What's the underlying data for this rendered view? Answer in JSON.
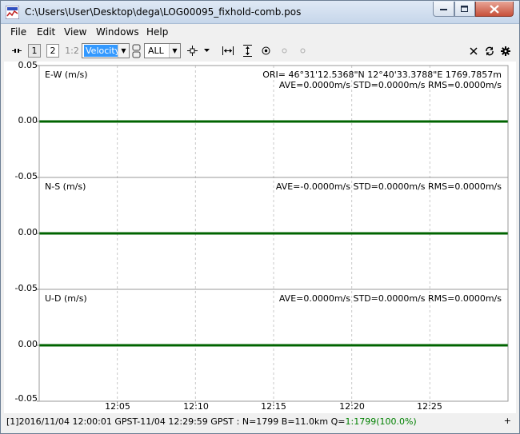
{
  "window": {
    "title": "C:\\Users\\User\\Desktop\\dega\\LOG00095_fixhold-comb.pos"
  },
  "menu": [
    "File",
    "Edit",
    "View",
    "Windows",
    "Help"
  ],
  "toolbar": {
    "plot1": "1",
    "plot2": "2",
    "plot12": "1:2",
    "plot_type": "Velocity",
    "sat_filter": "ALL"
  },
  "plot": {
    "panels": [
      {
        "label": "E-W (m/s)",
        "ori": "ORI= 46°31'12.5368\"N  12°40'33.3788\"E 1769.7857m",
        "stats": "AVE=0.0000m/s STD=0.0000m/s RMS=0.0000m/s"
      },
      {
        "label": "N-S (m/s)",
        "stats": "AVE=-0.0000m/s STD=0.0000m/s RMS=0.0000m/s"
      },
      {
        "label": "U-D (m/s)",
        "stats": "AVE=0.0000m/s STD=0.0000m/s RMS=0.0000m/s"
      }
    ],
    "y_ticks": [
      "0.05",
      "0.00",
      "-0.05",
      "0.00",
      "-0.05",
      "0.00",
      "-0.05"
    ],
    "x_ticks": [
      "12:05",
      "12:10",
      "12:15",
      "12:20",
      "12:25"
    ],
    "line_color": "#006400"
  },
  "chart_data": {
    "type": "line",
    "title": "",
    "x_ticks": [
      "12:05",
      "12:10",
      "12:15",
      "12:20",
      "12:25"
    ],
    "ylim": [
      -0.05,
      0.05
    ],
    "series": [
      {
        "name": "E-W (m/s)",
        "x": [
          "12:00:01",
          "12:29:59"
        ],
        "values": [
          0.0,
          0.0
        ]
      },
      {
        "name": "N-S (m/s)",
        "x": [
          "12:00:01",
          "12:29:59"
        ],
        "values": [
          0.0,
          0.0
        ]
      },
      {
        "name": "U-D (m/s)",
        "x": [
          "12:00:01",
          "12:29:59"
        ],
        "values": [
          0.0,
          0.0
        ]
      }
    ]
  },
  "status": {
    "text_prefix": "[1]2016/11/04 12:00:01 GPST-11/04 12:29:59 GPST : N=1799 B=11.0km Q=",
    "quality": "1:1799(100.0%)",
    "quality_color": "#008000",
    "corner": "+"
  }
}
